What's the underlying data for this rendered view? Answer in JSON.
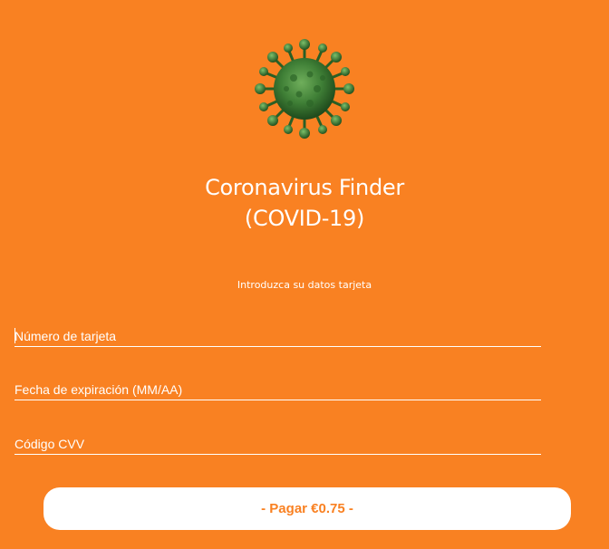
{
  "header": {
    "logo_icon": "coronavirus-icon",
    "title_line1": "Coronavirus Finder",
    "title_line2": "(COVID-19)"
  },
  "form": {
    "instruction": "Introduzca su datos tarjeta",
    "card_number_placeholder": "Número de tarjeta",
    "expiry_placeholder": "Fecha de expiración (MM/AA)",
    "cvv_placeholder": "Código CVV",
    "pay_label": "- Pagar €0.75 -"
  },
  "colors": {
    "background": "#f98122",
    "text": "#ffffff",
    "button_background": "#ffffff",
    "button_text": "#f98122",
    "virus": "#2e6b2a"
  }
}
